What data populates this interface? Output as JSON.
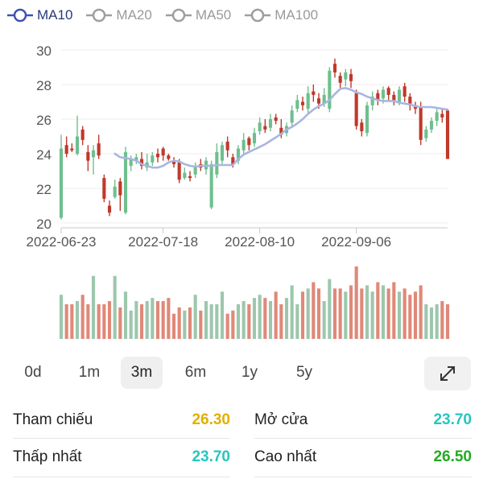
{
  "legend": [
    {
      "label": "MA10",
      "active": true,
      "color": "#3f51b5"
    },
    {
      "label": "MA20",
      "active": false,
      "color": "#9e9e9e"
    },
    {
      "label": "MA50",
      "active": false,
      "color": "#9e9e9e"
    },
    {
      "label": "MA100",
      "active": false,
      "color": "#9e9e9e"
    }
  ],
  "chart_data": {
    "type": "candlestick",
    "y_ticks": [
      "30",
      "28",
      "26",
      "24",
      "22",
      "20"
    ],
    "ylim": [
      20,
      30
    ],
    "x_labels": [
      "2022-06-23",
      "2022-07-18",
      "2022-08-10",
      "2022-09-06"
    ],
    "x_label_index": [
      0,
      19,
      37,
      55
    ],
    "colors": {
      "up": "#6fbf8f",
      "down": "#c0392b",
      "ma10": "#a8b6e0",
      "vol_up": "#9dc7ad",
      "vol_down": "#e08878"
    },
    "candles": [
      [
        20.3,
        24.3,
        20.2,
        25.1
      ],
      [
        24.5,
        24.0,
        23.8,
        25.0
      ],
      [
        24.3,
        24.2,
        24.1,
        24.6
      ],
      [
        24.0,
        25.0,
        23.9,
        26.2
      ],
      [
        25.4,
        24.8,
        24.5,
        25.6
      ],
      [
        24.1,
        23.6,
        23.0,
        24.5
      ],
      [
        23.8,
        24.2,
        22.8,
        24.5
      ],
      [
        24.6,
        23.9,
        23.7,
        25.1
      ],
      [
        22.6,
        21.4,
        21.2,
        22.8
      ],
      [
        21.0,
        20.6,
        20.4,
        21.3
      ],
      [
        21.5,
        22.1,
        21.4,
        22.5
      ],
      [
        22.4,
        21.6,
        20.7,
        22.6
      ],
      [
        20.6,
        24.1,
        20.5,
        24.4
      ],
      [
        23.3,
        23.7,
        23.0,
        23.9
      ],
      [
        23.6,
        23.8,
        23.4,
        24.0
      ],
      [
        23.7,
        23.3,
        23.1,
        24.1
      ],
      [
        23.2,
        23.5,
        23.0,
        24.0
      ],
      [
        23.5,
        23.9,
        23.3,
        24.1
      ],
      [
        24.0,
        23.8,
        23.5,
        24.3
      ],
      [
        24.3,
        23.9,
        23.6,
        24.4
      ],
      [
        23.9,
        23.7,
        23.6,
        24.0
      ],
      [
        23.6,
        23.4,
        23.2,
        23.8
      ],
      [
        23.5,
        22.5,
        22.3,
        23.7
      ],
      [
        22.6,
        22.9,
        22.5,
        23.2
      ],
      [
        22.7,
        22.6,
        22.4,
        23.0
      ],
      [
        22.8,
        23.3,
        22.6,
        23.5
      ],
      [
        23.4,
        23.2,
        23.0,
        23.7
      ],
      [
        23.1,
        23.6,
        22.8,
        23.8
      ],
      [
        20.9,
        23.4,
        20.8,
        23.6
      ],
      [
        22.8,
        24.1,
        22.6,
        24.6
      ],
      [
        23.6,
        24.5,
        23.4,
        24.7
      ],
      [
        24.7,
        24.2,
        23.8,
        25.0
      ],
      [
        23.8,
        23.4,
        23.2,
        24.0
      ],
      [
        23.6,
        24.3,
        23.4,
        24.5
      ],
      [
        24.2,
        24.8,
        24.0,
        25.2
      ],
      [
        24.9,
        24.5,
        24.2,
        25.0
      ],
      [
        24.6,
        25.2,
        24.4,
        25.5
      ],
      [
        25.3,
        25.8,
        25.1,
        26.1
      ],
      [
        25.6,
        25.4,
        25.2,
        26.0
      ],
      [
        25.5,
        26.0,
        25.3,
        26.3
      ],
      [
        26.1,
        25.9,
        25.7,
        26.3
      ],
      [
        25.5,
        25.1,
        24.9,
        26.0
      ],
      [
        25.2,
        25.6,
        25.0,
        25.8
      ],
      [
        25.8,
        26.5,
        25.6,
        26.8
      ],
      [
        26.6,
        27.1,
        26.4,
        27.4
      ],
      [
        27.0,
        26.8,
        26.5,
        27.3
      ],
      [
        26.6,
        27.5,
        26.3,
        27.9
      ],
      [
        27.6,
        27.4,
        27.0,
        28.0
      ],
      [
        27.2,
        26.9,
        26.6,
        27.5
      ],
      [
        26.9,
        27.4,
        26.7,
        27.8
      ],
      [
        26.6,
        28.8,
        26.4,
        29.0
      ],
      [
        29.2,
        28.7,
        28.4,
        29.5
      ],
      [
        28.5,
        28.1,
        27.8,
        28.7
      ],
      [
        28.3,
        28.7,
        27.9,
        28.9
      ],
      [
        28.6,
        28.2,
        27.8,
        28.9
      ],
      [
        27.5,
        25.6,
        25.4,
        27.7
      ],
      [
        25.8,
        25.3,
        25.0,
        26.0
      ],
      [
        25.2,
        26.8,
        25.0,
        27.0
      ],
      [
        26.8,
        27.3,
        26.5,
        27.6
      ],
      [
        27.5,
        27.1,
        26.8,
        27.7
      ],
      [
        27.2,
        27.7,
        26.9,
        27.9
      ],
      [
        27.8,
        27.4,
        27.1,
        27.9
      ],
      [
        27.4,
        27.0,
        26.8,
        27.6
      ],
      [
        27.0,
        27.7,
        26.8,
        27.9
      ],
      [
        27.9,
        27.3,
        27.0,
        28.1
      ],
      [
        27.3,
        26.8,
        26.5,
        27.5
      ],
      [
        26.8,
        26.6,
        26.3,
        27.0
      ],
      [
        26.7,
        24.8,
        24.5,
        27.0
      ],
      [
        24.9,
        25.4,
        24.7,
        25.6
      ],
      [
        25.4,
        25.9,
        25.2,
        26.1
      ],
      [
        25.9,
        26.4,
        25.6,
        26.6
      ],
      [
        26.3,
        26.1,
        25.8,
        26.6
      ],
      [
        26.5,
        23.7,
        23.7,
        26.5
      ]
    ],
    "ma10": [
      null,
      null,
      null,
      null,
      null,
      null,
      null,
      null,
      null,
      null,
      24.0,
      23.8,
      23.75,
      23.7,
      23.6,
      23.4,
      23.3,
      23.2,
      23.2,
      23.3,
      23.5,
      23.6,
      23.55,
      23.4,
      23.3,
      23.25,
      23.3,
      23.3,
      23.3,
      23.35,
      23.35,
      23.35,
      23.35,
      23.7,
      23.95,
      24.1,
      24.25,
      24.4,
      24.55,
      24.75,
      24.95,
      25.15,
      25.4,
      25.55,
      25.75,
      26.0,
      26.3,
      26.55,
      26.75,
      26.9,
      27.1,
      27.45,
      27.75,
      27.8,
      27.7,
      27.55,
      27.45,
      27.3,
      27.2,
      27.1,
      27.05,
      27.05,
      27.05,
      26.95,
      26.9,
      26.85,
      26.75,
      26.7,
      26.7,
      26.7,
      26.65,
      26.6,
      26.55
    ],
    "volume": [
      0.7,
      0.55,
      0.55,
      0.6,
      0.7,
      0.55,
      1.0,
      0.55,
      0.55,
      0.6,
      1.0,
      0.5,
      0.75,
      0.45,
      0.6,
      0.55,
      0.6,
      0.65,
      0.6,
      0.6,
      0.65,
      0.4,
      0.5,
      0.45,
      0.5,
      0.7,
      0.45,
      0.6,
      0.55,
      0.55,
      0.75,
      0.4,
      0.45,
      0.55,
      0.6,
      0.55,
      0.65,
      0.7,
      0.65,
      0.6,
      0.75,
      0.55,
      0.65,
      0.85,
      0.55,
      0.75,
      0.8,
      0.9,
      0.8,
      0.6,
      0.95,
      0.8,
      0.8,
      0.75,
      0.85,
      1.15,
      0.8,
      0.85,
      0.75,
      0.9,
      0.85,
      0.8,
      0.9,
      0.75,
      0.8,
      0.7,
      0.75,
      0.85,
      0.55,
      0.5,
      0.55,
      0.6,
      0.55
    ]
  },
  "ranges": [
    {
      "label": "0d",
      "selected": false
    },
    {
      "label": "1m",
      "selected": false
    },
    {
      "label": "3m",
      "selected": true
    },
    {
      "label": "6m",
      "selected": false
    },
    {
      "label": "1y",
      "selected": false
    },
    {
      "label": "5y",
      "selected": false
    }
  ],
  "stats": {
    "tham_chieu": {
      "label": "Tham chiếu",
      "value": "26.30",
      "color": "#e0b000"
    },
    "mo_cua": {
      "label": "Mở cửa",
      "value": "23.70",
      "color": "#25c6c0"
    },
    "thap_nhat": {
      "label": "Thấp nhất",
      "value": "23.70",
      "color": "#25c6c0"
    },
    "cao_nhat": {
      "label": "Cao nhất",
      "value": "26.50",
      "color": "#22aa22"
    }
  }
}
